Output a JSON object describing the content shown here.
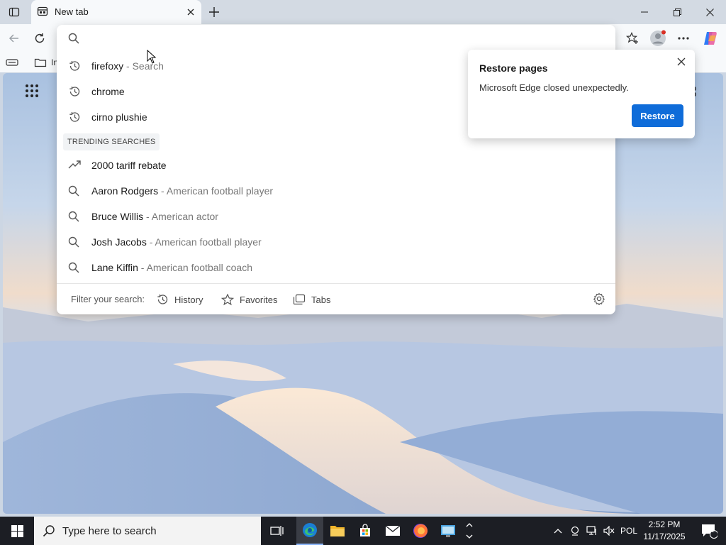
{
  "tab": {
    "title": "New tab"
  },
  "omnibox": {
    "value": ""
  },
  "favorites_bar": {
    "items": [
      {
        "label": "In"
      }
    ]
  },
  "suggestions": {
    "history": [
      {
        "text": "firefoxy",
        "sub": " - Search"
      },
      {
        "text": "chrome",
        "sub": ""
      },
      {
        "text": "cirno plushie",
        "sub": ""
      }
    ],
    "trending_label": "TRENDING SEARCHES",
    "trending": [
      {
        "icon": "trending-arrow-icon",
        "text": "2000 tariff rebate",
        "sub": ""
      },
      {
        "icon": "search-icon",
        "text": "Aaron Rodgers",
        "sub": " - American football player"
      },
      {
        "icon": "search-icon",
        "text": "Bruce Willis",
        "sub": " - American actor"
      },
      {
        "icon": "search-icon",
        "text": "Josh Jacobs",
        "sub": " - American football player"
      },
      {
        "icon": "search-icon",
        "text": "Lane Kiffin",
        "sub": " - American football coach"
      }
    ]
  },
  "filter": {
    "label": "Filter your search:",
    "history": "History",
    "favorites": "Favorites",
    "tabs": "Tabs"
  },
  "restore_popup": {
    "title": "Restore pages",
    "message": "Microsoft Edge closed unexpectedly.",
    "button": "Restore"
  },
  "taskbar": {
    "search_placeholder": "Type here to search",
    "language": "POL",
    "time": "2:52 PM",
    "date": "11/17/2025",
    "notification_count": "1"
  },
  "colors": {
    "accent": "#0f6cd9",
    "taskbar": "#1c1e24",
    "tabbar": "#d3dae3"
  }
}
